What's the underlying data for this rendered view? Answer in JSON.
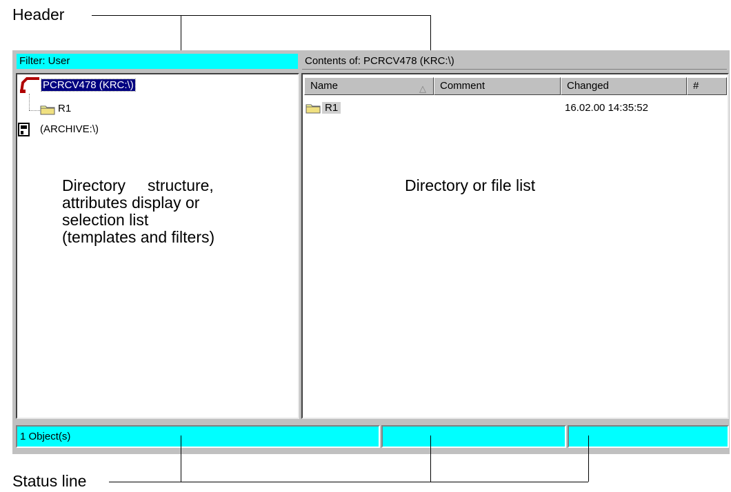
{
  "callouts": {
    "header": "Header",
    "status_line": "Status line"
  },
  "header": {
    "filter": "Filter: User",
    "contents": "Contents of: PCRCV478 (KRC:\\)"
  },
  "tree": {
    "root": "PCRCV478 (KRC:\\)",
    "child": "R1",
    "archive": "(ARCHIVE:\\)"
  },
  "left_label": {
    "line1": "Directory     structure,",
    "line2": "attributes display or",
    "line3": "selection list",
    "line4": "(templates and filters)"
  },
  "columns": {
    "name": "Name",
    "comment": "Comment",
    "changed": "Changed",
    "num": "#"
  },
  "files": [
    {
      "name": "R1",
      "comment": "",
      "changed": "16.02.00 14:35:52"
    }
  ],
  "right_label": "Directory or file list",
  "status": {
    "objects": "1 Object(s)",
    "field2": "",
    "field3": ""
  },
  "icons": {
    "robot": "robot-icon",
    "folder": "folder-icon",
    "drive": "archive-drive-icon",
    "sort": "sort-ascending-icon"
  },
  "colors": {
    "highlight": "#00ffff",
    "panel": "#c0c0c0",
    "selection": "#000080"
  }
}
